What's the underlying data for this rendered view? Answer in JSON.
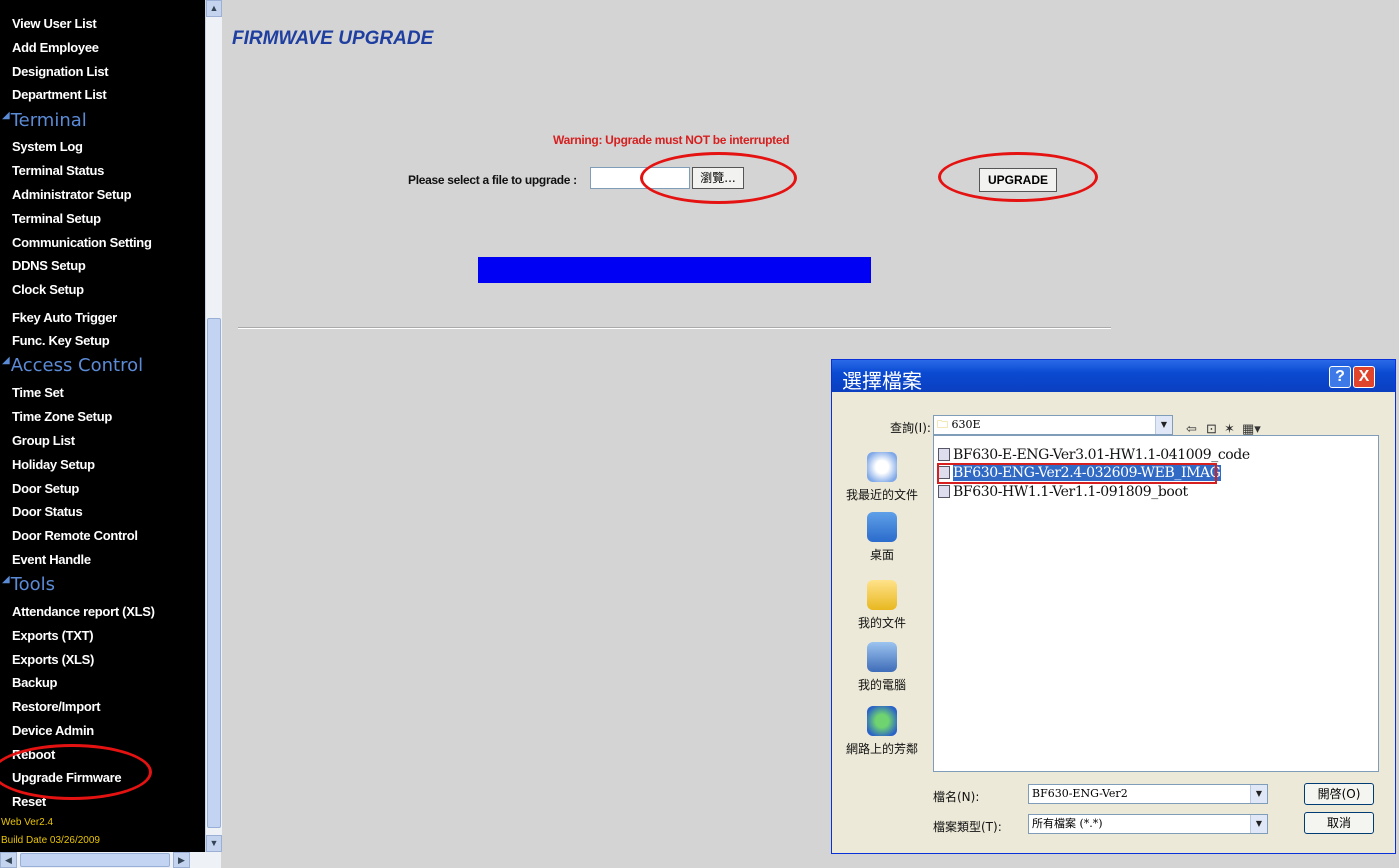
{
  "sidebar": {
    "items_group1": [
      "View User List",
      "Add Employee",
      "Designation List",
      "Department List"
    ],
    "section_terminal": "Terminal",
    "items_terminal": [
      "System Log",
      "Terminal Status",
      "Administrator Setup",
      "Terminal Setup",
      "Communication Setting",
      "DDNS Setup",
      "Clock Setup",
      "Fkey Auto Trigger",
      "Func. Key Setup"
    ],
    "section_access": "Access Control",
    "items_access": [
      "Time Set",
      "Time Zone Setup",
      "Group List",
      "Holiday Setup",
      "Door Setup",
      "Door Status",
      "Door Remote Control",
      "Event Handle"
    ],
    "section_tools": "Tools",
    "items_tools": [
      "Attendance report (XLS)",
      "Exports (TXT)",
      "Exports (XLS)",
      "Backup",
      "Restore/Import",
      "Device Admin",
      "Reboot",
      "Upgrade Firmware",
      "Reset"
    ],
    "web_version": "Web Ver2.4",
    "build_date": "Build Date 03/26/2009"
  },
  "main": {
    "title": "FIRMWAVE UPGRADE",
    "warning": "Warning: Upgrade must NOT be interrupted",
    "select_label": "Please select a file to upgrade :",
    "browse_label": "瀏覽...",
    "upgrade_label": "UPGRADE",
    "progress": 1.0
  },
  "dialog": {
    "title": "選擇檔案",
    "help": "?",
    "close": "X",
    "lookin_label": "查詢(I):",
    "lookin_value": "630E",
    "places": [
      "我最近的文件",
      "桌面",
      "我的文件",
      "我的電腦",
      "網路上的芳鄰"
    ],
    "files": [
      "BF630-E-ENG-Ver3.01-HW1.1-041009_code",
      "BF630-ENG-Ver2.4-032609-WEB_IMAG",
      "BF630-HW1.1-Ver1.1-091809_boot"
    ],
    "selected_file_index": 1,
    "filename_label": "檔名(N):",
    "filename_value": "BF630-ENG-Ver2",
    "filetype_label": "檔案類型(T):",
    "filetype_value": "所有檔案 (*.*)",
    "open_label": "開啓(O)",
    "cancel_label": "取消"
  },
  "colors": {
    "accent_annotation": "#e51212",
    "progress": "#0000f4",
    "title": "#1e3ea0",
    "warning": "#d62020"
  }
}
